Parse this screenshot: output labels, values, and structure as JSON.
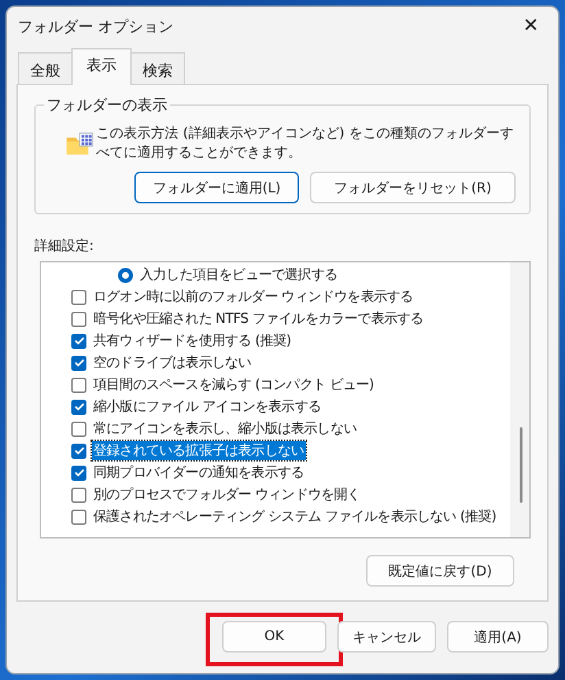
{
  "window": {
    "title": "フォルダー オプション",
    "close": "✕"
  },
  "tabs": [
    {
      "label": "全般",
      "selected": false
    },
    {
      "label": "表示",
      "selected": true
    },
    {
      "label": "検索",
      "selected": false
    }
  ],
  "folder_views": {
    "title": "フォルダーの表示",
    "description": "この表示方法 (詳細表示やアイコンなど) をこの種類のフォルダーすべてに適用することができます。",
    "buttons": [
      {
        "label": "フォルダーに適用(L)",
        "focused": true
      },
      {
        "label": "フォルダーをリセット(R)",
        "focused": false
      }
    ]
  },
  "advanced": {
    "label": "詳細設定:",
    "items": [
      {
        "kind": "radio",
        "label": "入力した項目をビューで選択する",
        "checked": true,
        "selected": false
      },
      {
        "kind": "checkbox",
        "label": "ログオン時に以前のフォルダー ウィンドウを表示する",
        "checked": false,
        "selected": false
      },
      {
        "kind": "checkbox",
        "label": "暗号化や圧縮された NTFS ファイルをカラーで表示する",
        "checked": false,
        "selected": false
      },
      {
        "kind": "checkbox",
        "label": "共有ウィザードを使用する (推奨)",
        "checked": true,
        "selected": false
      },
      {
        "kind": "checkbox",
        "label": "空のドライブは表示しない",
        "checked": true,
        "selected": false
      },
      {
        "kind": "checkbox",
        "label": "項目間のスペースを減らす (コンパクト ビュー)",
        "checked": false,
        "selected": false
      },
      {
        "kind": "checkbox",
        "label": "縮小版にファイル アイコンを表示する",
        "checked": true,
        "selected": false
      },
      {
        "kind": "checkbox",
        "label": "常にアイコンを表示し、縮小版は表示しない",
        "checked": false,
        "selected": false
      },
      {
        "kind": "checkbox",
        "label": "登録されている拡張子は表示しない",
        "checked": true,
        "selected": true
      },
      {
        "kind": "checkbox",
        "label": "同期プロバイダーの通知を表示する",
        "checked": true,
        "selected": false
      },
      {
        "kind": "checkbox",
        "label": "別のプロセスでフォルダー ウィンドウを開く",
        "checked": false,
        "selected": false
      },
      {
        "kind": "checkbox",
        "label": "保護されたオペレーティング システム ファイルを表示しない (推奨)",
        "checked": false,
        "selected": false
      }
    ],
    "restore_button": "既定値に戻す(D)"
  },
  "buttons": [
    {
      "label": "OK",
      "highlighted": true
    },
    {
      "label": "キャンセル",
      "highlighted": false
    },
    {
      "label": "適用(A)",
      "highlighted": false
    }
  ]
}
